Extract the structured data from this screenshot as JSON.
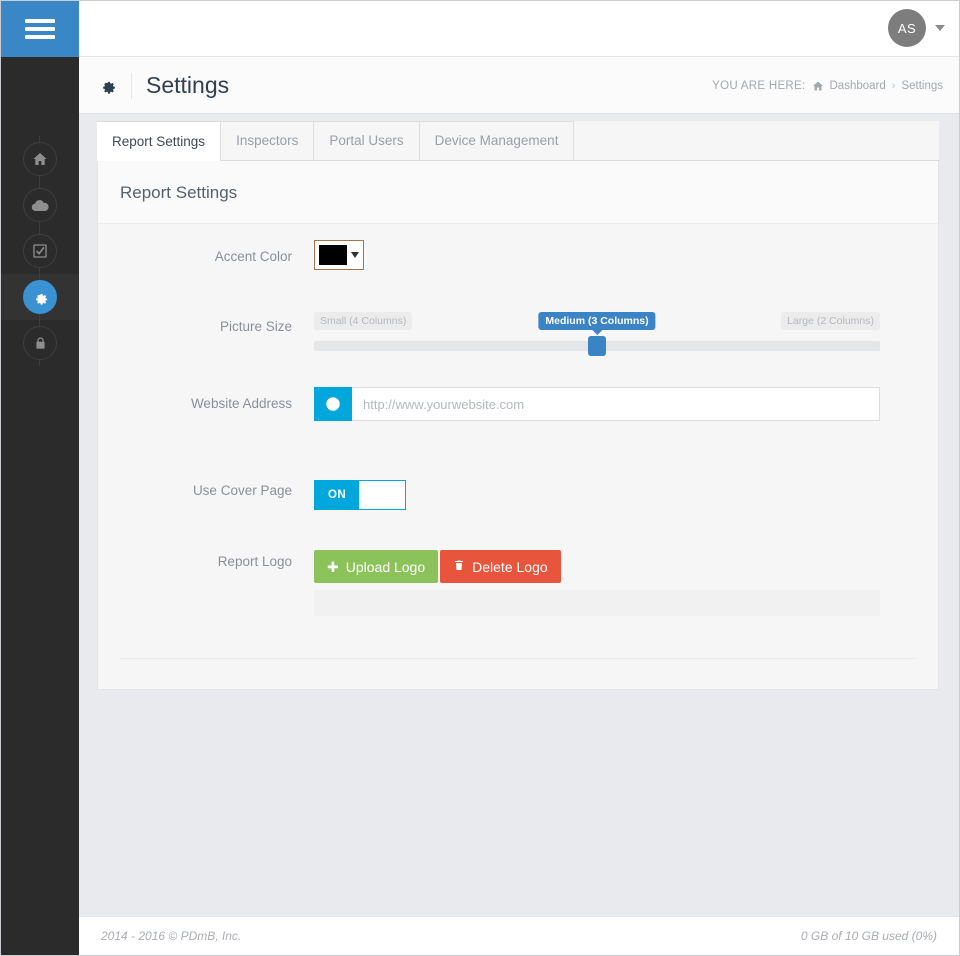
{
  "sidebar": {
    "toggle_icon": "hamburger-icon",
    "items": [
      {
        "icon": "home-icon",
        "name": "home",
        "active": false
      },
      {
        "icon": "cloud-icon",
        "name": "cloud",
        "active": false
      },
      {
        "icon": "check-square-icon",
        "name": "inspections",
        "active": false
      },
      {
        "icon": "gear-icon",
        "name": "settings",
        "active": true
      },
      {
        "icon": "lock-icon",
        "name": "security",
        "active": false
      }
    ]
  },
  "topbar": {
    "avatar_initials": "AS",
    "avatar_icon": "user-avatar",
    "caret_icon": "chevron-down-icon"
  },
  "page_header": {
    "icon": "gear-icon",
    "title": "Settings",
    "breadcrumb": {
      "prefix": "YOU ARE HERE:",
      "home_icon": "home-icon",
      "items": [
        "Dashboard",
        "Settings"
      ],
      "separator": "›"
    }
  },
  "tabs": [
    {
      "label": "Report Settings",
      "active": true
    },
    {
      "label": "Inspectors",
      "active": false
    },
    {
      "label": "Portal Users",
      "active": false
    },
    {
      "label": "Device Management",
      "active": false
    }
  ],
  "panel": {
    "heading": "Report Settings"
  },
  "form": {
    "accent_color": {
      "label": "Accent Color",
      "value": "#000000",
      "border_color": "#a3764f",
      "caret_icon": "caret-down-icon"
    },
    "picture_size": {
      "label": "Picture Size",
      "min_label": "Small (4 Columns)",
      "selected_label": "Medium (3 Columns)",
      "max_label": "Large (2 Columns)",
      "value": 2,
      "min": 1,
      "max": 3,
      "accent": "#3a84c5"
    },
    "website_address": {
      "label": "Website Address",
      "addon_icon": "globe-icon",
      "addon_color": "#00a7dd",
      "value": "",
      "placeholder": "http://www.yourwebsite.com"
    },
    "use_cover_page": {
      "label": "Use Cover Page",
      "state_label": "ON",
      "on": true,
      "accent": "#00a7dd"
    },
    "report_logo": {
      "label": "Report Logo",
      "upload_label": "Upload Logo",
      "upload_icon": "plus-icon",
      "upload_color": "#8cc25a",
      "delete_label": "Delete Logo",
      "delete_icon": "trash-icon",
      "delete_color": "#e8553d"
    }
  },
  "footer": {
    "copyright": "2014 - 2016 © PDmB, Inc.",
    "storage": "0 GB of 10 GB used (0%)"
  }
}
